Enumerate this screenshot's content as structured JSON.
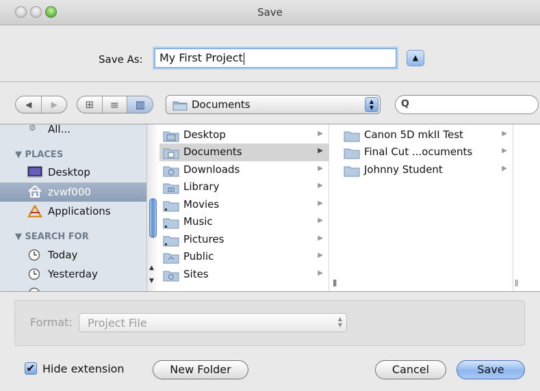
{
  "window": {
    "title": "Save"
  },
  "save_as": {
    "label": "Save As:",
    "value": "My First Project"
  },
  "toolbar": {
    "back_glyph": "◀",
    "forward_glyph": "▶",
    "view_icons": "⊞",
    "view_list": "≡",
    "view_columns": "▥",
    "location": "Documents",
    "search_placeholder": ""
  },
  "sidebar": {
    "partial_top": "All...",
    "places_header": "▼ PLACES",
    "places": [
      {
        "label": "Desktop",
        "icon": "desktop-icon"
      },
      {
        "label": "zvwf000",
        "icon": "home-icon",
        "selected": true
      },
      {
        "label": "Applications",
        "icon": "applications-icon"
      }
    ],
    "search_header": "▼ SEARCH FOR",
    "search_for": [
      {
        "label": "Today",
        "icon": "clock-icon"
      },
      {
        "label": "Yesterday",
        "icon": "clock-icon"
      }
    ]
  },
  "column1": {
    "items": [
      {
        "label": "Desktop",
        "arrow": "▶"
      },
      {
        "label": "Documents",
        "arrow": "▶",
        "selected": true
      },
      {
        "label": "Downloads",
        "arrow": "▶"
      },
      {
        "label": "Library",
        "arrow": "▶"
      },
      {
        "label": "Movies",
        "arrow": "▶"
      },
      {
        "label": "Music",
        "arrow": "▶"
      },
      {
        "label": "Pictures",
        "arrow": "▶"
      },
      {
        "label": "Public",
        "arrow": "▶"
      },
      {
        "label": "Sites",
        "arrow": "▶"
      }
    ]
  },
  "column2": {
    "items": [
      {
        "label": "Canon 5D mkII Test",
        "arrow": "▶"
      },
      {
        "label": "Final Cut ...ocuments",
        "arrow": "▶"
      },
      {
        "label": "Johnny Student",
        "arrow": "▶"
      }
    ]
  },
  "format": {
    "label": "Format:",
    "value": "Project File"
  },
  "bottom": {
    "hide_extension_label": "Hide extension",
    "hide_extension_checked": true,
    "new_folder_label": "New Folder",
    "cancel_label": "Cancel",
    "save_label": "Save"
  },
  "colors": {
    "accent": "#8fb8ef",
    "sidebar_bg": "#dde4ec",
    "selection": "#d4d4d4"
  }
}
